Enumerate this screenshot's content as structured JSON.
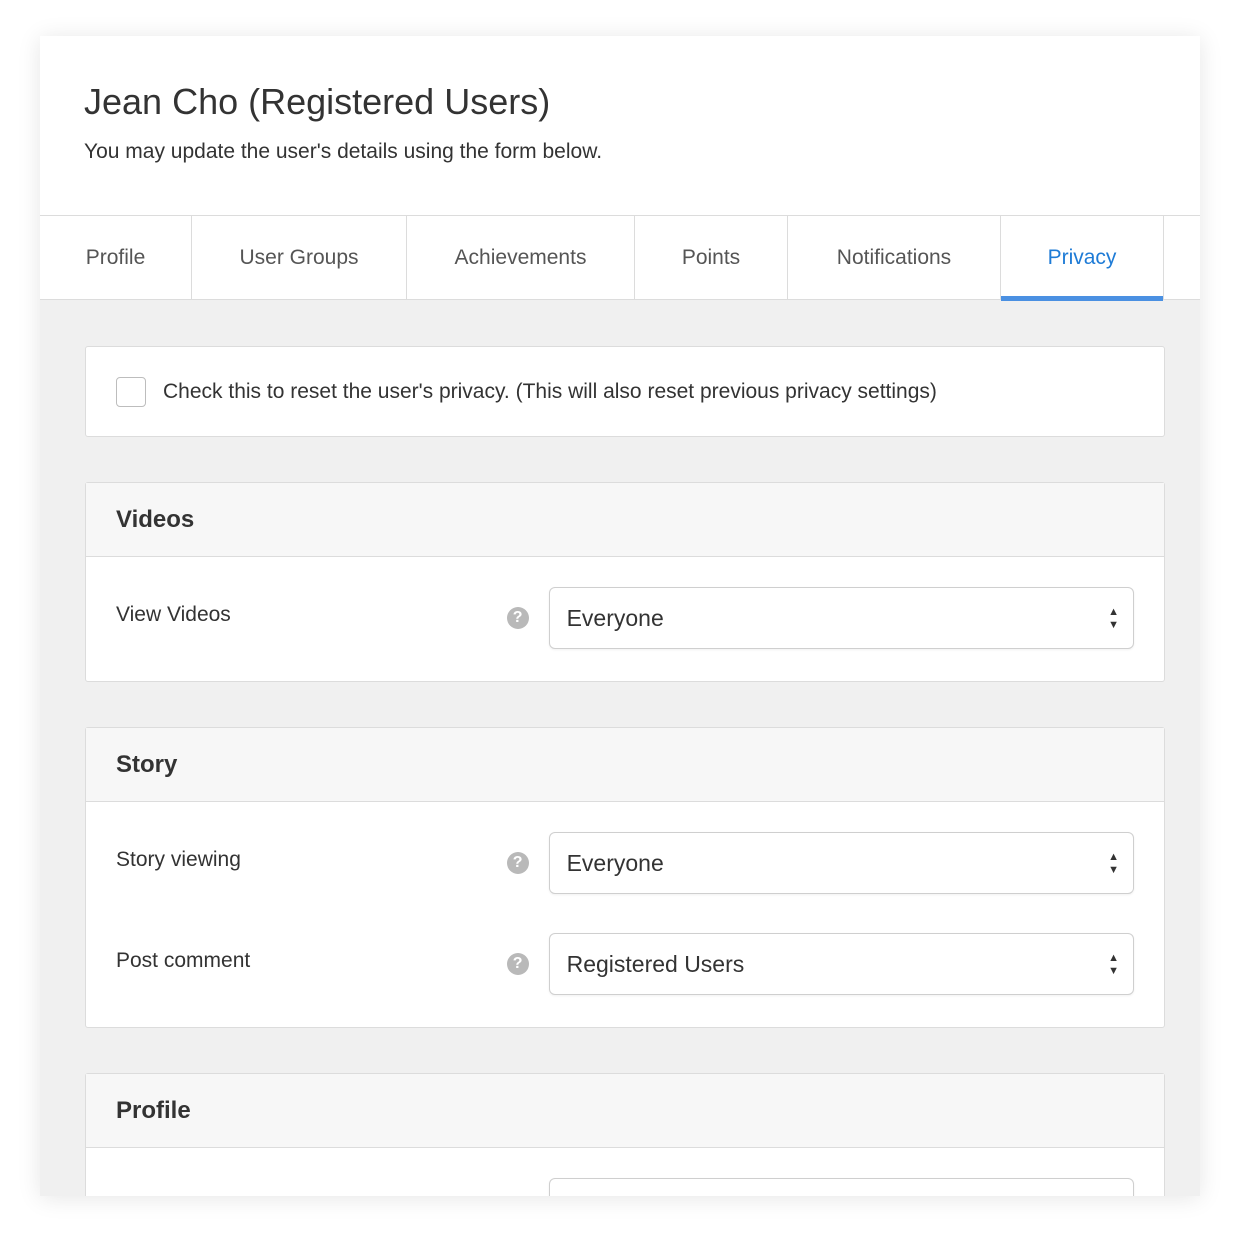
{
  "header": {
    "title": "Jean Cho (Registered Users)",
    "subtitle": "You may update the user's details using the form below."
  },
  "tabs": [
    {
      "label": "Profile",
      "active": false
    },
    {
      "label": "User Groups",
      "active": false
    },
    {
      "label": "Achievements",
      "active": false
    },
    {
      "label": "Points",
      "active": false
    },
    {
      "label": "Notifications",
      "active": false
    },
    {
      "label": "Privacy",
      "active": true
    }
  ],
  "reset": {
    "label": "Check this to reset the user's privacy. (This will also reset previous privacy settings)",
    "checked": false
  },
  "sections": {
    "videos": {
      "title": "Videos",
      "rows": [
        {
          "label": "View Videos",
          "value": "Everyone"
        }
      ]
    },
    "story": {
      "title": "Story",
      "rows": [
        {
          "label": "Story viewing",
          "value": "Everyone"
        },
        {
          "label": "Post comment",
          "value": "Registered Users"
        }
      ]
    },
    "profile": {
      "title": "Profile"
    }
  },
  "icons": {
    "help": "?",
    "select_up": "▲",
    "select_down": "▼"
  },
  "colors": {
    "accent": "#4a90e2",
    "active_tab_text": "#1e7bd6",
    "content_bg": "#f0f0f0"
  }
}
